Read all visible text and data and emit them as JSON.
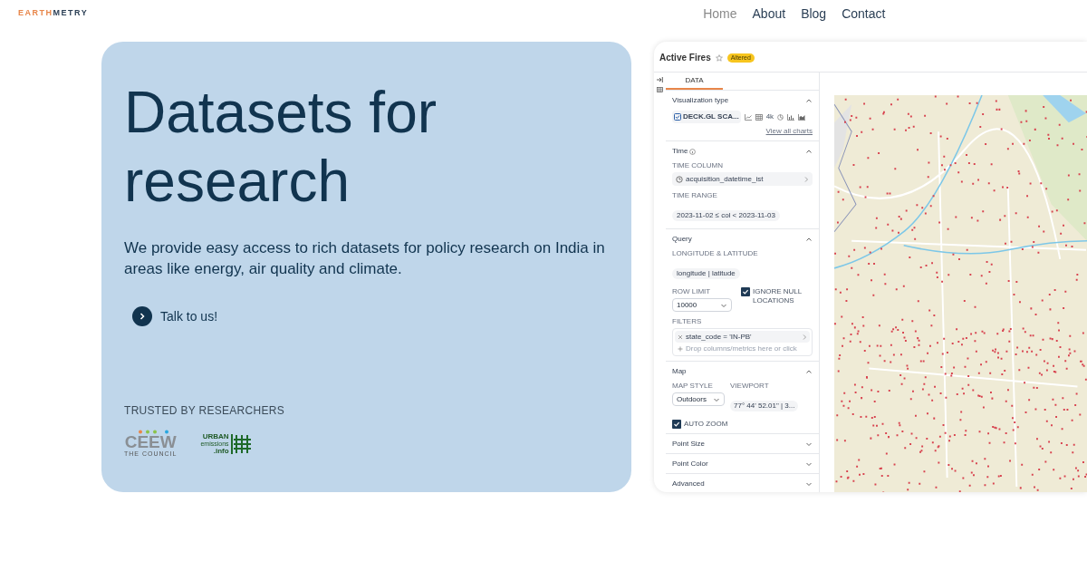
{
  "header": {
    "logo": [
      {
        "text": "EARTH",
        "color": "#e8864a"
      },
      {
        "text": "METRY",
        "color": "#2b3f55"
      }
    ],
    "nav": [
      {
        "label": "Home",
        "selected": true
      },
      {
        "label": "About",
        "selected": false
      },
      {
        "label": "Blog",
        "selected": false
      },
      {
        "label": "Contact",
        "selected": false
      }
    ]
  },
  "hero": {
    "title": "Datasets for research",
    "description": "We provide easy access to rich datasets for policy research on India in areas like energy, air quality and climate.",
    "cta": "Talk to us!",
    "trusted_label": "TRUSTED BY RESEARCHERS",
    "partners": [
      {
        "kind": "ceew",
        "name": "CEEW",
        "tagline": "THE COUNCIL"
      },
      {
        "kind": "urban",
        "lines": [
          "URBAN",
          "emissions",
          ".info"
        ]
      }
    ]
  },
  "app": {
    "title": "Active Fires",
    "starred": false,
    "badge": "Altered",
    "tab": {
      "label": "DATA",
      "selected": true
    },
    "sections": [
      {
        "title": "Visualization type",
        "info": false,
        "expanded": true,
        "controls": [
          {
            "kind": "viz",
            "chip": "DECK.GL SCA...",
            "icon_text": "4k",
            "link": "View all charts"
          }
        ]
      },
      {
        "title": "Time",
        "info": true,
        "expanded": true,
        "controls": [
          {
            "kind": "select-row",
            "label": "TIME COLUMN",
            "value": "acquisition_datetime_ist"
          },
          {
            "kind": "pill",
            "label": "TIME RANGE",
            "value": "2023-11-02 ≤ col < 2023-11-03"
          }
        ]
      },
      {
        "title": "Query",
        "info": false,
        "expanded": true,
        "controls": [
          {
            "kind": "pill",
            "label": "LONGITUDE & LATITUDE",
            "value": "longitude | latitude"
          },
          {
            "kind": "limit",
            "label": "ROW LIMIT",
            "value": "10000",
            "checkbox": {
              "label": "IGNORE NULL LOCATIONS",
              "checked": true
            }
          },
          {
            "kind": "filters",
            "label": "FILTERS",
            "value": "state_code = 'IN-PB'",
            "placeholder": "Drop columns/metrics here or click"
          }
        ]
      },
      {
        "title": "Map",
        "info": false,
        "expanded": true,
        "controls": [
          {
            "kind": "mapstyle",
            "label": "MAP STYLE",
            "value": "Outdoors",
            "viewport_label": "VIEWPORT",
            "viewport": "77° 44' 52.01\" | 3..."
          },
          {
            "kind": "checkbox",
            "label": "AUTO ZOOM",
            "checked": true
          }
        ]
      },
      {
        "title": "Point Size",
        "info": false,
        "expanded": false
      },
      {
        "title": "Point Color",
        "info": false,
        "expanded": false
      },
      {
        "title": "Advanced",
        "info": false,
        "expanded": false
      }
    ]
  }
}
